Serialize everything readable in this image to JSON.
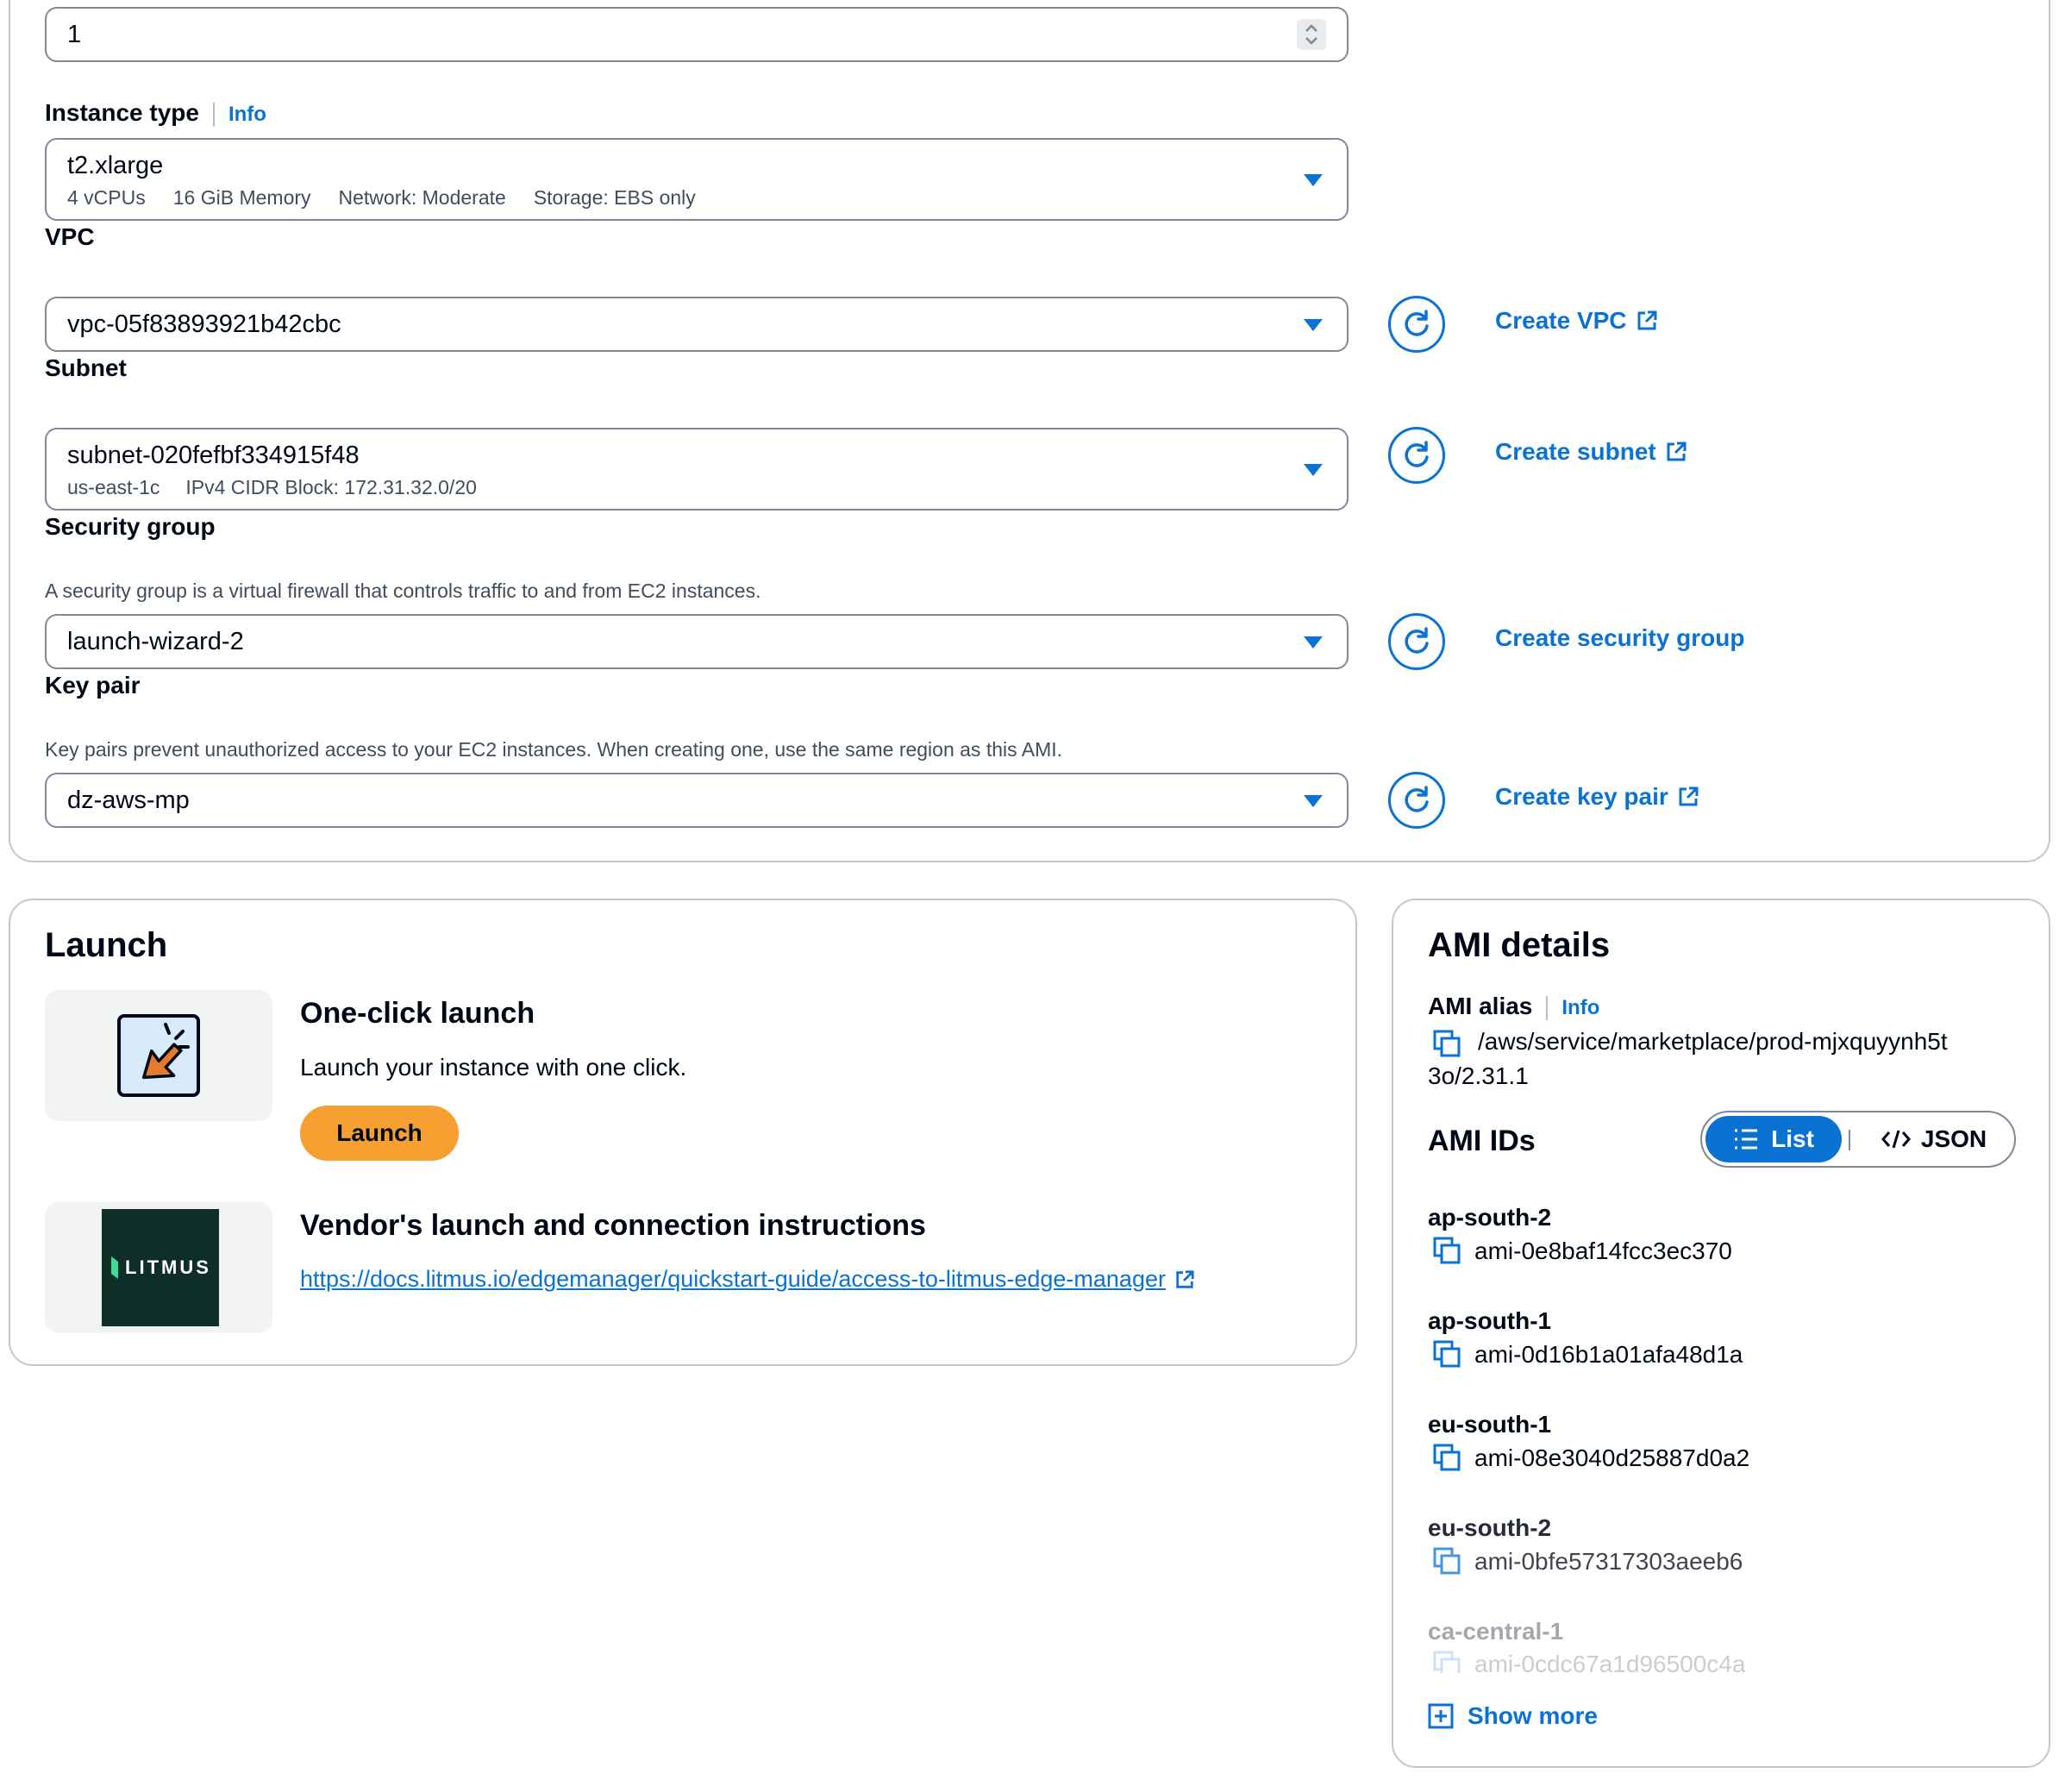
{
  "config": {
    "quantity_value": "1",
    "instance_type": {
      "label": "Instance type",
      "info": "Info",
      "value": "t2.xlarge",
      "vcpus": "4 vCPUs",
      "memory": "16 GiB Memory",
      "network": "Network: Moderate",
      "storage": "Storage: EBS only"
    },
    "vpc": {
      "label": "VPC",
      "value": "vpc-05f83893921b42cbc",
      "create_link": "Create VPC"
    },
    "subnet": {
      "label": "Subnet",
      "value": "subnet-020fefbf334915f48",
      "az": "us-east-1c",
      "cidr": "IPv4 CIDR Block: 172.31.32.0/20",
      "create_link": "Create subnet"
    },
    "security_group": {
      "label": "Security group",
      "description": "A security group is a virtual firewall that controls traffic to and from EC2 instances.",
      "value": "launch-wizard-2",
      "create_link": "Create security group"
    },
    "key_pair": {
      "label": "Key pair",
      "description": "Key pairs prevent unauthorized access to your EC2 instances. When creating one, use the same region as this AMI.",
      "value": "dz-aws-mp",
      "create_link": "Create key pair"
    }
  },
  "launch": {
    "title": "Launch",
    "one_click": {
      "title": "One-click launch",
      "description": "Launch your instance with one click.",
      "button": "Launch"
    },
    "vendor": {
      "title": "Vendor's launch and connection instructions",
      "logo_text": "LITMUS",
      "link": "https://docs.litmus.io/edgemanager/quickstart-guide/access-to-litmus-edge-manager"
    }
  },
  "ami_details": {
    "title": "AMI details",
    "alias_label": "AMI alias",
    "info": "Info",
    "alias_line1": "/aws/service/marketplace/prod-mjxquyynh5t",
    "alias_line2": "3o/2.31.1",
    "ids_title": "AMI IDs",
    "toggle_list": "List",
    "toggle_json": "JSON",
    "ids": [
      {
        "region": "ap-south-2",
        "ami": "ami-0e8baf14fcc3ec370"
      },
      {
        "region": "ap-south-1",
        "ami": "ami-0d16b1a01afa48d1a"
      },
      {
        "region": "eu-south-1",
        "ami": "ami-08e3040d25887d0a2"
      },
      {
        "region": "eu-south-2",
        "ami": "ami-0bfe57317303aeeb6"
      },
      {
        "region": "ca-central-1",
        "ami": "ami-0cdc67a1d96500c4a"
      }
    ],
    "show_more": "Show more"
  },
  "colors": {
    "link": "#0972d3",
    "launch_button": "#f5a031",
    "border": "#7d8998",
    "logo_bg": "#0e2e28"
  }
}
